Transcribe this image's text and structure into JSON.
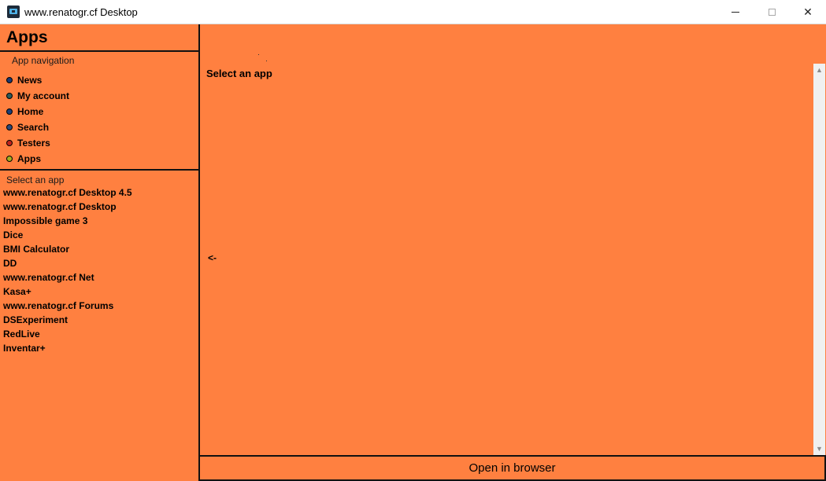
{
  "window": {
    "title": "www.renatogr.cf Desktop",
    "icon": "app-logo-icon",
    "controls": {
      "minimize_icon": "minimize-icon",
      "maximize_icon": "maximize-icon",
      "close_glyph": "✕"
    }
  },
  "sidebar": {
    "title": "Apps",
    "navigation": {
      "heading": "App navigation",
      "items": [
        {
          "label": "News",
          "dot_color": "#1b3a73"
        },
        {
          "label": "My account",
          "dot_color": "#2b5a5a"
        },
        {
          "label": "Home",
          "dot_color": "#1a3f7a"
        },
        {
          "label": "Search",
          "dot_color": "#2a4a7a"
        },
        {
          "label": "Testers",
          "dot_color": "#c0241c"
        },
        {
          "label": "Apps",
          "dot_color": "#a4b020"
        }
      ]
    },
    "app_list": {
      "heading": "Select an app",
      "items": [
        "www.renatogr.cf Desktop 4.5",
        "www.renatogr.cf Desktop",
        "Impossible game 3",
        "Dice",
        "BMI Calculator",
        "DD",
        "www.renatogr.cf Net",
        "Kasa+",
        "www.renatogr.cf Forums",
        "DSExperiment",
        "RedLive",
        "Inventar+"
      ]
    }
  },
  "main": {
    "heading": "Select an app",
    "back_label": "<-",
    "scrollbar": {
      "up_glyph": "▲",
      "down_glyph": "▼"
    }
  },
  "footer": {
    "open_browser_label": "Open in browser"
  },
  "colors": {
    "accent": "#ff8040",
    "border": "#111111"
  }
}
